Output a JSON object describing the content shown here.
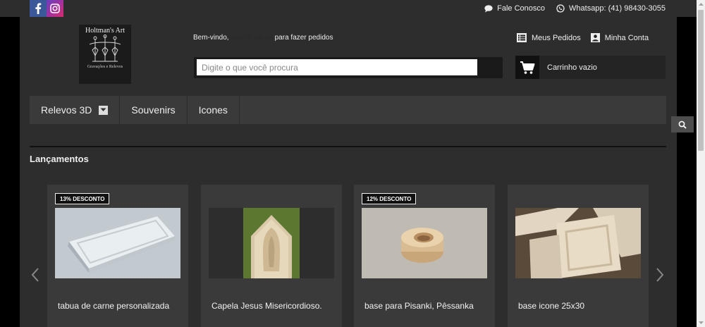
{
  "social": {
    "facebook_icon": "facebook-icon",
    "instagram_icon": "instagram-icon"
  },
  "toplinks": {
    "contact_label": "Fale Conosco",
    "whatsapp_label": "Whatsapp: (41) 98430-3055"
  },
  "logo": {
    "title": "Holtman's Art",
    "subtitle": "Gravações e Relevos"
  },
  "welcome": {
    "prefix": "Bem-vindo,",
    "link": "identifique-se",
    "suffix": "para fazer pedidos"
  },
  "search": {
    "placeholder": "Digite o que você procura",
    "value": ""
  },
  "account": {
    "orders_label": "Meus Pedidos",
    "account_label": "Minha Conta"
  },
  "cart": {
    "label": "Carrinho vazio"
  },
  "nav": {
    "items": [
      {
        "label": "Relevos 3D"
      },
      {
        "label": "Souvenirs"
      },
      {
        "label": "Icones"
      }
    ]
  },
  "section": {
    "title": "Lançamentos"
  },
  "products": [
    {
      "name": "tabua de carne personalizada",
      "badge": "13% DESCONTO"
    },
    {
      "name": "Capela Jesus Misericordioso.",
      "badge": ""
    },
    {
      "name": "base para Pisanki, Pêssanka",
      "badge": "12% DESCONTO"
    },
    {
      "name": "base icone 25x30",
      "badge": ""
    }
  ],
  "colors": {
    "background": "#2d2d2d",
    "nav": "#3a3a3a",
    "facebook": "#3b5998",
    "accent_dark": "#111111"
  }
}
